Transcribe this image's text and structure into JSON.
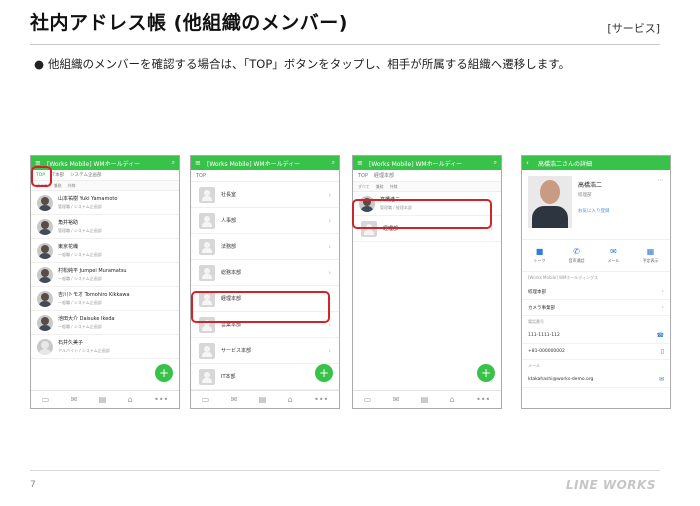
{
  "page": {
    "title": "社内アドレス帳 (他組織のメンバー)",
    "tag": "[サービス]",
    "bullet": "他組織のメンバーを確認する場合は、「TOP」ボタンをタップし、相手が所属する組織へ遷移します。",
    "page_number": "7",
    "logo": "LINE WORKS",
    "accent_color": "#38c24a",
    "highlight_color": "#d2232a"
  },
  "screen1": {
    "header": "[Works Mobile] WMホールディー",
    "tabs": [
      "TOP",
      "IT本部",
      "システム企画部"
    ],
    "subtabs": [
      "すべて",
      "兼務",
      "外線"
    ],
    "members": [
      {
        "name": "山本祐樹 Yuki Yamamoto",
        "dept": "管理職 / システム企画部"
      },
      {
        "name": "角井裕助",
        "dept": "管理職 / システム企画部"
      },
      {
        "name": "東京花織",
        "dept": "一般職 / システム企画部"
      },
      {
        "name": "村松純平 Jumpei Muramatsu",
        "dept": "一般職 / システム企画部"
      },
      {
        "name": "吉川トモオ Tomohiro Kikkawa",
        "dept": "一般職 / システム企画部"
      },
      {
        "name": "池田大介 Daisuke Ikeda",
        "dept": "一般職 / システム企画部"
      },
      {
        "name": "石井久美子",
        "dept": "アルバイト / システム企画部"
      }
    ]
  },
  "screen2": {
    "header": "[Works Mobile] WMホールディー",
    "crumb": "TOP",
    "depts": [
      "社長室",
      "人事部",
      "法務部",
      "総務本部",
      "経理本部",
      "営業本部",
      "サービス本部",
      "IT本部"
    ]
  },
  "screen3": {
    "header": "[Works Mobile] WMホールディー",
    "crumb": [
      "TOP",
      "経理本部"
    ],
    "subtabs": [
      "すべて",
      "兼務",
      "外線"
    ],
    "members": [
      {
        "name": "高橋浩二",
        "dept": "管理職 / 経理本部"
      }
    ],
    "depts": [
      "経理部"
    ]
  },
  "screen4": {
    "header": "高橋浩二さんの詳細",
    "name": "高橋浩二",
    "dept": "経理部",
    "favorite": "お気に入り登録",
    "actions": [
      {
        "icon": "chat-icon",
        "glyph": "■",
        "label": "トーク"
      },
      {
        "icon": "phone-icon",
        "glyph": "✆",
        "label": "音声通話"
      },
      {
        "icon": "mail-icon",
        "glyph": "✉",
        "label": "メール"
      },
      {
        "icon": "calendar-icon",
        "glyph": "▦",
        "label": "予定表示"
      }
    ],
    "company": "[Works Mobile] WMホールディングス",
    "org_lines": [
      "経理本部",
      "カメラ事業部"
    ],
    "phone_label": "電話番号",
    "phones": [
      "111-1111-112",
      "+81-000000002"
    ],
    "mail_label": "メール",
    "email": "ktakahashi@works-demo.org"
  }
}
